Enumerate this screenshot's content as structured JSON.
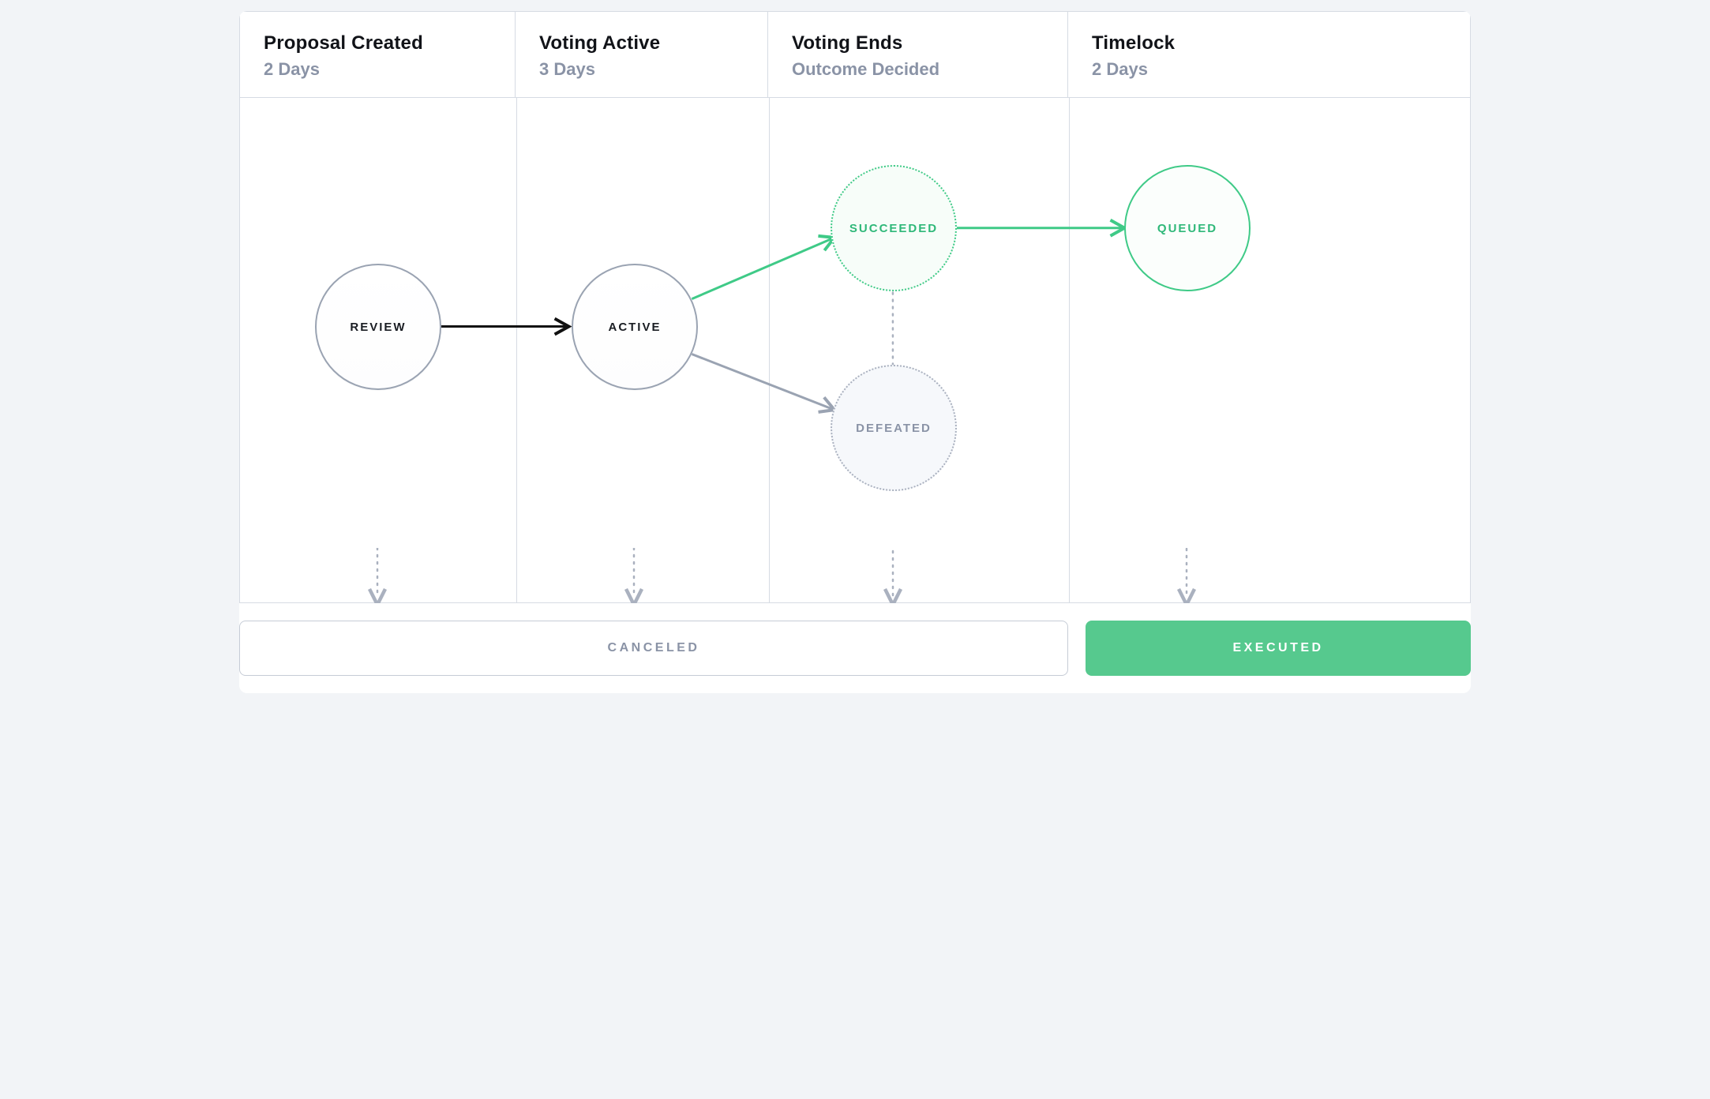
{
  "columns": [
    {
      "title": "Proposal Created",
      "sub": "2 Days"
    },
    {
      "title": "Voting Active",
      "sub": "3 Days"
    },
    {
      "title": "Voting Ends",
      "sub": "Outcome Decided"
    },
    {
      "title": "Timelock",
      "sub": "2 Days"
    }
  ],
  "nodes": {
    "review": "REVIEW",
    "active": "ACTIVE",
    "succeeded": "SUCCEEDED",
    "defeated": "DEFEATED",
    "queued": "QUEUED"
  },
  "footer": {
    "canceled": "CANCELED",
    "executed": "EXECUTED"
  },
  "edges": [
    {
      "from": "review",
      "to": "active",
      "style": "solid-black"
    },
    {
      "from": "active",
      "to": "succeeded",
      "style": "solid-green"
    },
    {
      "from": "active",
      "to": "defeated",
      "style": "solid-gray"
    },
    {
      "from": "succeeded",
      "to": "queued",
      "style": "solid-green"
    },
    {
      "from": "review",
      "to": "canceled",
      "style": "dotted-gray-down"
    },
    {
      "from": "active",
      "to": "canceled",
      "style": "dotted-gray-down"
    },
    {
      "from": "succeeded",
      "to": "defeated",
      "style": "dotted-gray-down-short"
    },
    {
      "from": "defeated",
      "to": "canceled",
      "style": "dotted-gray-down"
    },
    {
      "from": "queued",
      "to": "executed",
      "style": "dotted-gray-down"
    }
  ]
}
